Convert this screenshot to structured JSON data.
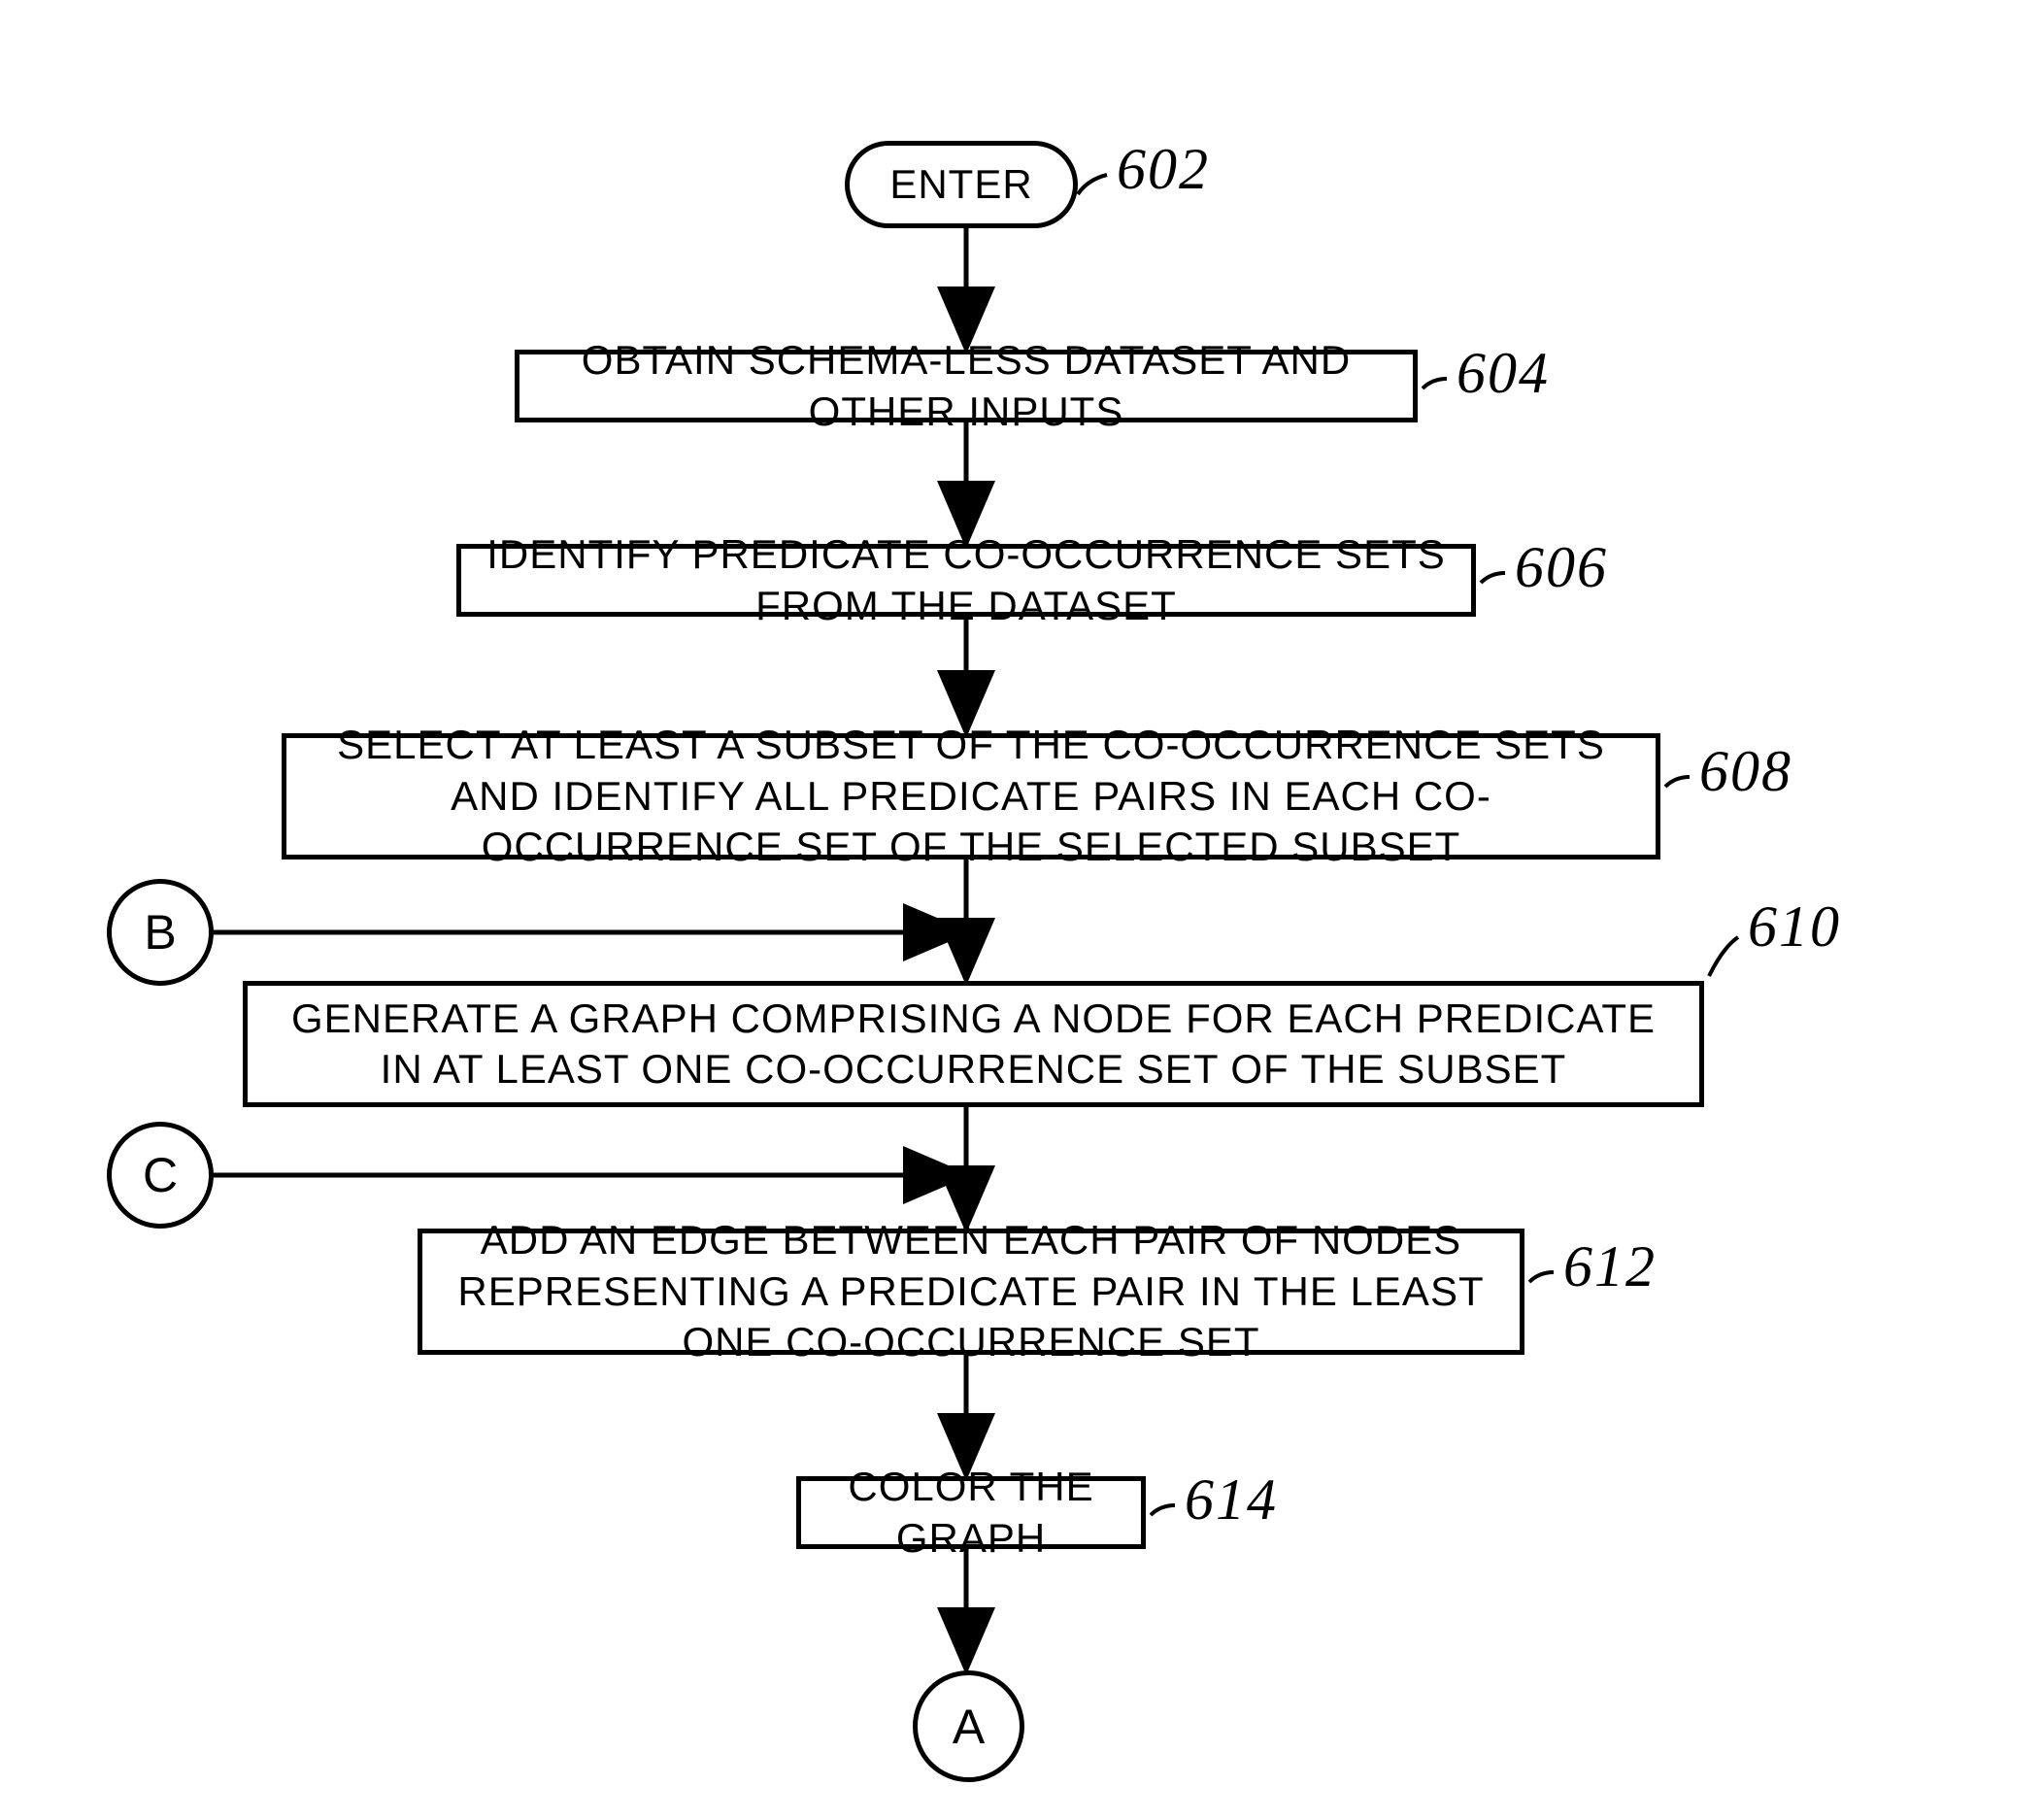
{
  "nodes": {
    "enter": "ENTER",
    "step604": "OBTAIN SCHEMA-LESS DATASET AND OTHER INPUTS",
    "step606": "IDENTIFY PREDICATE CO-OCCURRENCE SETS FROM THE DATASET",
    "step608": "SELECT AT LEAST A SUBSET OF THE CO-OCCURRENCE SETS AND IDENTIFY ALL PREDICATE PAIRS IN EACH CO-OCCURRENCE SET OF THE SELECTED SUBSET",
    "step610": "GENERATE A GRAPH COMPRISING A NODE FOR EACH PREDICATE IN AT LEAST ONE CO-OCCURRENCE SET OF THE SUBSET",
    "step612": "ADD AN EDGE BETWEEN EACH PAIR OF NODES REPRESENTING A PREDICATE PAIR IN THE LEAST ONE CO-OCCURRENCE SET",
    "step614": "COLOR THE GRAPH",
    "connB": "B",
    "connC": "C",
    "connA": "A"
  },
  "labels": {
    "l602": "602",
    "l604": "604",
    "l606": "606",
    "l608": "608",
    "l610": "610",
    "l612": "612",
    "l614": "614"
  }
}
